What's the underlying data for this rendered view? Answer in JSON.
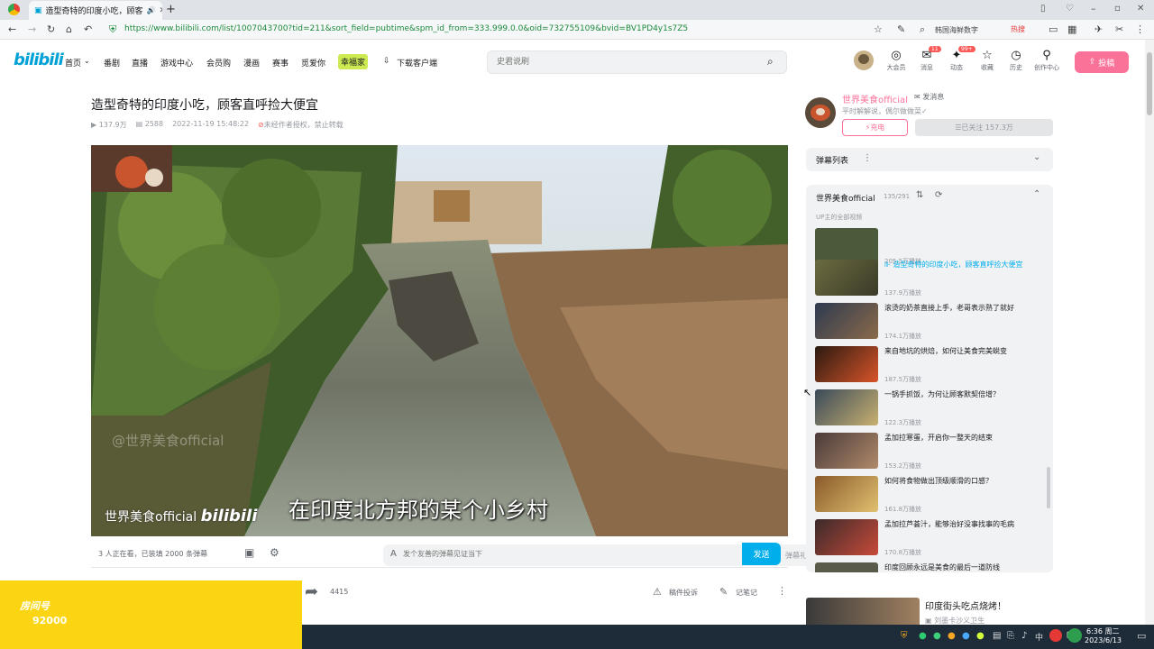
{
  "browser": {
    "tab_title": "造型奇特的印度小吃，顾客",
    "url": "https://www.bilibili.com/list/1007043700?tid=211&sort_field=pubtime&spm_id_from=333.999.0.0&oid=732755109&bvid=BV1PD4y1s7Z5",
    "search_hint": "韩国海鲜数字",
    "hot_label": "热搜"
  },
  "header": {
    "logo": "bilibili",
    "nav": [
      "首页",
      "番剧",
      "直播",
      "游戏中心",
      "会员购",
      "漫画",
      "赛事",
      "觅爱你",
      "幸福家",
      "下载客户端"
    ],
    "search_placeholder": "史君说刷",
    "icons": [
      {
        "label": "大会员",
        "glyph": "◎"
      },
      {
        "label": "消息",
        "glyph": "✉",
        "badge": "11"
      },
      {
        "label": "动态",
        "glyph": "✦",
        "badge": "99+"
      },
      {
        "label": "收藏",
        "glyph": "☆"
      },
      {
        "label": "历史",
        "glyph": "◷"
      },
      {
        "label": "创作中心",
        "glyph": "⚲"
      }
    ],
    "upload_label": "投稿"
  },
  "video": {
    "title": "造型奇特的印度小吃，顾客直呼捡大便宜",
    "views": "137.9万",
    "danmaku_count": "2588",
    "date": "2022-11-19 15:48:22",
    "copyright": "未经作者授权，禁止转载",
    "subtitle": "在印度北方邦的某个小乡村",
    "watermark": "世界美食official",
    "watermark_logo": "bilibili",
    "watermark_faint": "@世界美食official"
  },
  "danmaku_bar": {
    "viewers": "3 人正在看，已装填 2000 条弹幕",
    "input_placeholder": "发个友善的弹幕见证当下",
    "etiquette": "弹幕礼仪 ›",
    "send": "发送"
  },
  "actions": {
    "share_count": "4415",
    "report": "稿件投诉",
    "notes": "记笔记"
  },
  "uploader": {
    "name": "世界美食official",
    "message": "发消息",
    "desc": "平时解解说，偶尔做做菜✓",
    "charge": "充电",
    "follow": "已关注 157.3万"
  },
  "danmaku_list": {
    "label": "弹幕列表"
  },
  "playlist": {
    "title": "世界美食official",
    "count": "135/291",
    "subtitle": "UP主的全部视频",
    "items": [
      {
        "title": "",
        "views": "205.5万播放"
      },
      {
        "title": "造型奇特的印度小吃，顾客直呼捡大便宜",
        "views": "137.9万播放",
        "active": true
      },
      {
        "title": "滚烫的奶茶直接上手，老哥表示熟了就好",
        "views": "174.1万播放"
      },
      {
        "title": "来自地坑的烘焙，如何让美食完美蜕变",
        "views": "187.5万播放"
      },
      {
        "title": "一锅手抓饭，为何让顾客默契倍增？",
        "views": "122.3万播放"
      },
      {
        "title": "孟加拉寒蛋，开启你一整天的结束",
        "views": "153.2万播放"
      },
      {
        "title": "如何将食物做出顶级顺滑的口感？",
        "views": "161.8万播放"
      },
      {
        "title": "孟加拉芦荟汁，能够治好没事找事的毛病",
        "views": "170.8万播放"
      },
      {
        "title": "印度回顾永远是美食的最后一道防线",
        "views": ""
      }
    ]
  },
  "recommend": {
    "title": "印度街头吃点烧烤！",
    "author": "刘墨卡沙义卫生"
  },
  "ad": {
    "number": "92000",
    "label": "房间号"
  },
  "taskbar": {
    "time": "6:36 周二",
    "date": "2023/6/13",
    "ime": "中"
  }
}
